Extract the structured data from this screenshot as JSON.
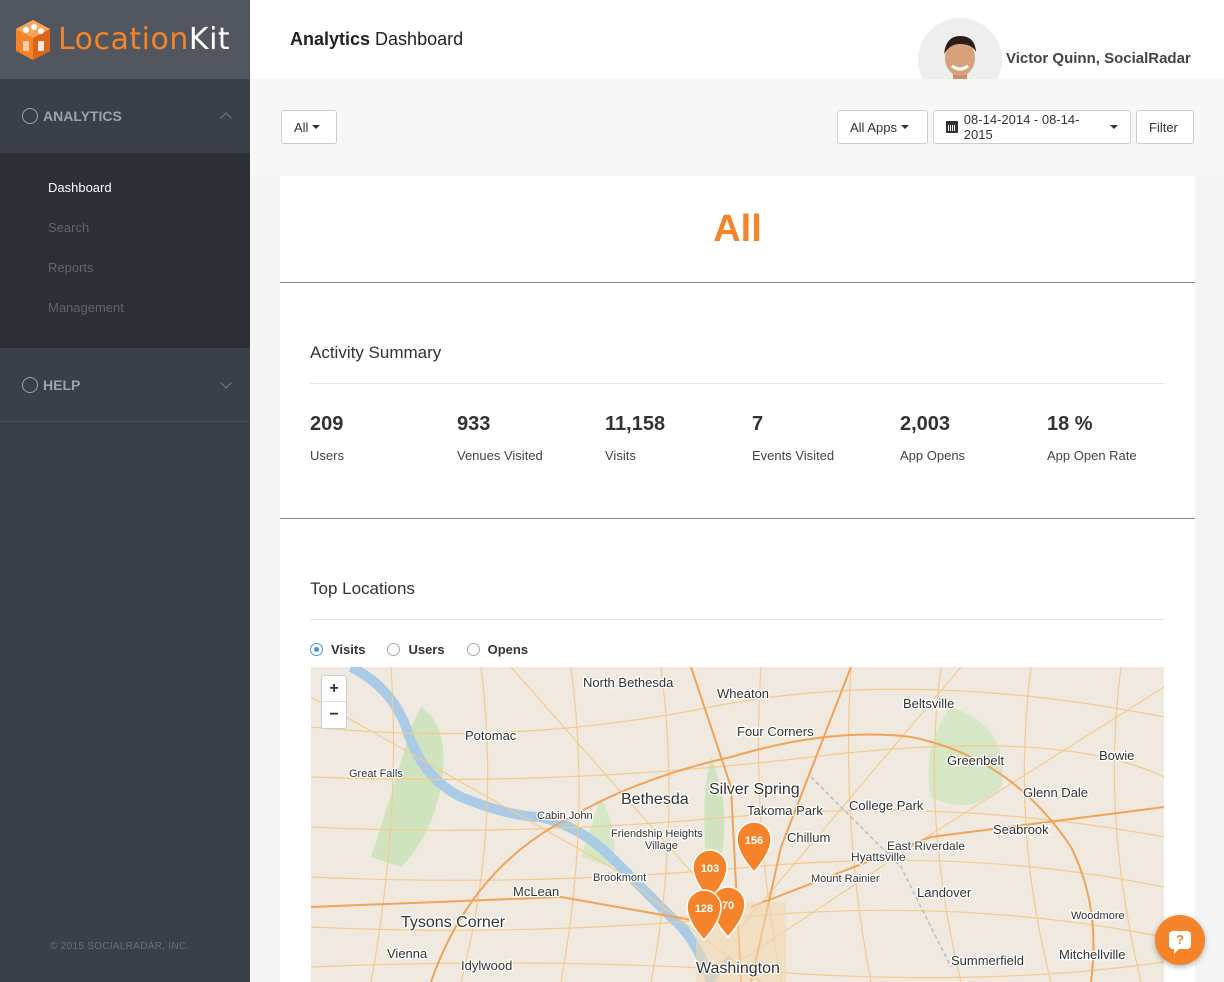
{
  "brand": {
    "name_part1": "Location",
    "name_part2": "Kit",
    "accent": "#f48329"
  },
  "sidebar": {
    "sections": [
      {
        "label": "ANALYTICS",
        "expanded": true
      },
      {
        "label": "HELP",
        "expanded": false
      }
    ],
    "items": [
      {
        "label": "Dashboard",
        "active": true
      },
      {
        "label": "Search",
        "active": false
      },
      {
        "label": "Reports",
        "active": false
      },
      {
        "label": "Management",
        "active": false
      }
    ],
    "footer": "© 2015 SOCIALRADAR, INC."
  },
  "header": {
    "title_bold": "Analytics",
    "title_rest": " Dashboard",
    "user_name": "Victor Quinn, SocialRadar"
  },
  "toolbar": {
    "scope_select": "All",
    "apps_select": "All Apps",
    "date_range": "08-14-2014 - 08-14-2015",
    "filter_label": "Filter"
  },
  "main": {
    "title": "All",
    "activity_summary": {
      "heading": "Activity Summary",
      "stats": [
        {
          "value": "209",
          "label": "Users"
        },
        {
          "value": "933",
          "label": "Venues Visited"
        },
        {
          "value": "11,158",
          "label": "Visits"
        },
        {
          "value": "7",
          "label": "Events Visited"
        },
        {
          "value": "2,003",
          "label": "App Opens"
        },
        {
          "value": "18 %",
          "label": "App Open Rate"
        }
      ]
    },
    "top_locations": {
      "heading": "Top Locations",
      "metrics": [
        {
          "label": "Visits",
          "selected": true
        },
        {
          "label": "Users",
          "selected": false
        },
        {
          "label": "Opens",
          "selected": false
        }
      ],
      "map": {
        "zoom_in": "+",
        "zoom_out": "−",
        "places": [
          "North Bethesda",
          "Wheaton",
          "Beltsville",
          "Potomac",
          "Four Corners",
          "Bowie",
          "Greenbelt",
          "Great Falls",
          "Silver Spring",
          "Bethesda",
          "Takoma Park",
          "College Park",
          "Glenn Dale",
          "Cabin John",
          "Friendship Heights",
          "Village",
          "Chillum",
          "Seabrook",
          "East Riverdale",
          "Hyattsville",
          "Brookmont",
          "Mount Rainier",
          "McLean",
          "Landover",
          "Tysons Corner",
          "Woodmore",
          "Vienna",
          "Idylwood",
          "Washington",
          "Summerfield",
          "Mitchellville"
        ],
        "markers": [
          {
            "count": "156"
          },
          {
            "count": "103"
          },
          {
            "count": "70"
          },
          {
            "count": "128"
          }
        ]
      }
    }
  },
  "chat": {
    "icon": "?"
  }
}
